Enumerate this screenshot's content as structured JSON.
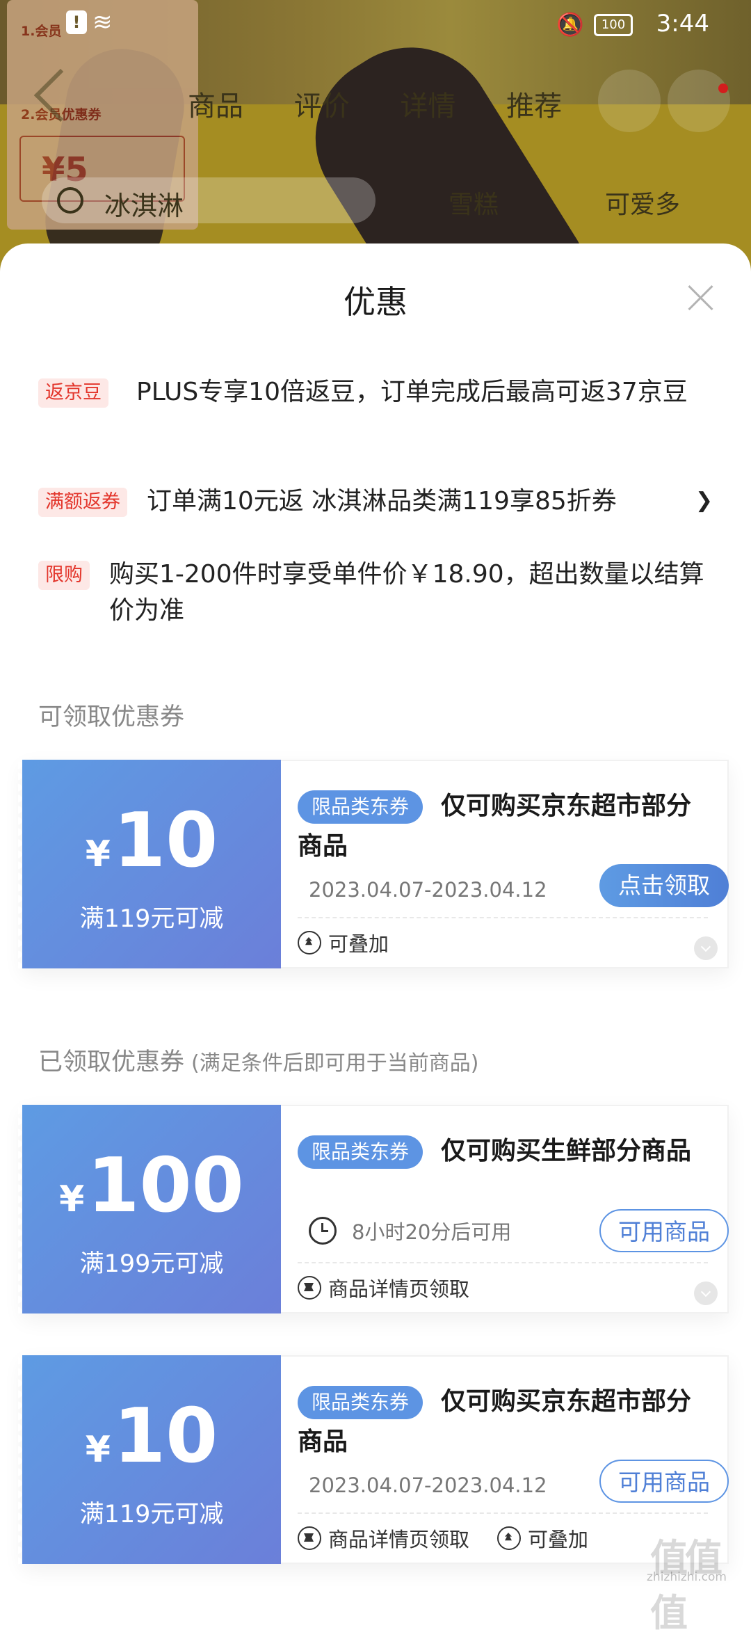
{
  "status_bar": {
    "time": "3:44",
    "battery": "100"
  },
  "background_page": {
    "tabs": [
      "商品",
      "评价",
      "详情",
      "推荐"
    ],
    "search_query": "冰淇淋",
    "categories": [
      "雪糕",
      "可爱多"
    ],
    "promo_steps": [
      "1.会员",
      "2.会员优惠券"
    ],
    "promo_coupon_value": "¥5"
  },
  "sheet": {
    "title": "优惠",
    "promotions": [
      {
        "tag": "返京豆",
        "text": "PLUS专享10倍返豆，订单完成后最高可返37京豆"
      },
      {
        "tag": "满额返券",
        "text": "订单满10元返 冰淇淋品类满119享85折券"
      },
      {
        "tag": "限购",
        "text": "购买1-200件时享受单件价￥18.90，超出数量以结算价为准"
      }
    ],
    "available_section": {
      "title": "可领取优惠券"
    },
    "claimed_section": {
      "title": "已领取优惠券",
      "subtitle": "(满足条件后即可用于当前商品)"
    },
    "coupons": [
      {
        "currency": "¥",
        "amount": "10",
        "condition": "满119元可减",
        "badge": "限品类东券",
        "title": "仅可购买京东超市部分商品",
        "date": "2023.04.07-2023.04.12",
        "button": "点击领取",
        "features": [
          "可叠加"
        ]
      },
      {
        "currency": "¥",
        "amount": "100",
        "condition": "满199元可减",
        "badge": "限品类东券",
        "title": "仅可购买生鲜部分商品",
        "timer": "8小时20分后可用",
        "button": "可用商品",
        "features": [
          "商品详情页领取"
        ]
      },
      {
        "currency": "¥",
        "amount": "10",
        "condition": "满119元可减",
        "badge": "限品类东券",
        "title": "仅可购买京东超市部分商品",
        "date": "2023.04.07-2023.04.12",
        "button": "可用商品",
        "features": [
          "商品详情页领取",
          "可叠加"
        ]
      }
    ]
  },
  "watermark": {
    "logo": "值值值",
    "url": "zhizhizhi.com"
  },
  "colors": {
    "coupon_gradient_start": "#5e9be3",
    "coupon_gradient_end": "#6b7fd9",
    "tag_red": "#e3352b",
    "tag_bg": "#fde8e6"
  }
}
